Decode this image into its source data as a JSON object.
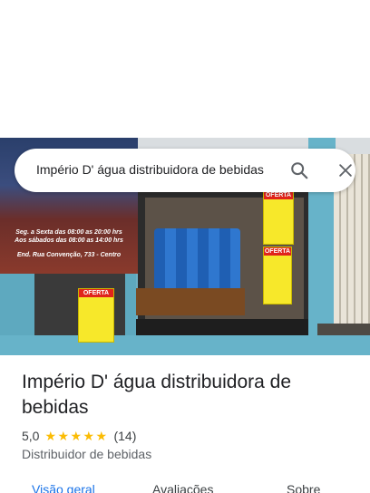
{
  "search": {
    "query": "Império D' água distribuidora de bebidas",
    "search_icon": "search-icon",
    "close_icon": "close-icon"
  },
  "photo": {
    "banner_hours_1": "Seg. a Sexta das 08:00 as 20:00 hrs",
    "banner_hours_2": "Aos sábados das 08:00 as 14:00 hrs",
    "banner_address": "End. Rua Convenção, 733 - Centro",
    "sign_label_1": "OFERTA",
    "sign_label_2": "OFERTA",
    "sign_label_3": "OFERTA"
  },
  "place": {
    "title": "Império D' água distribuidora de bebidas",
    "rating": "5,0",
    "stars": 5,
    "review_count": "(14)",
    "category": "Distribuidor de bebidas"
  },
  "tabs": [
    {
      "label": "Visão geral",
      "active": true
    },
    {
      "label": "Avaliações",
      "active": false
    },
    {
      "label": "Sobre",
      "active": false
    }
  ],
  "colors": {
    "accent": "#1a73e8",
    "star": "#fbbc04",
    "text": "#202124",
    "secondary_text": "#5f6368"
  }
}
